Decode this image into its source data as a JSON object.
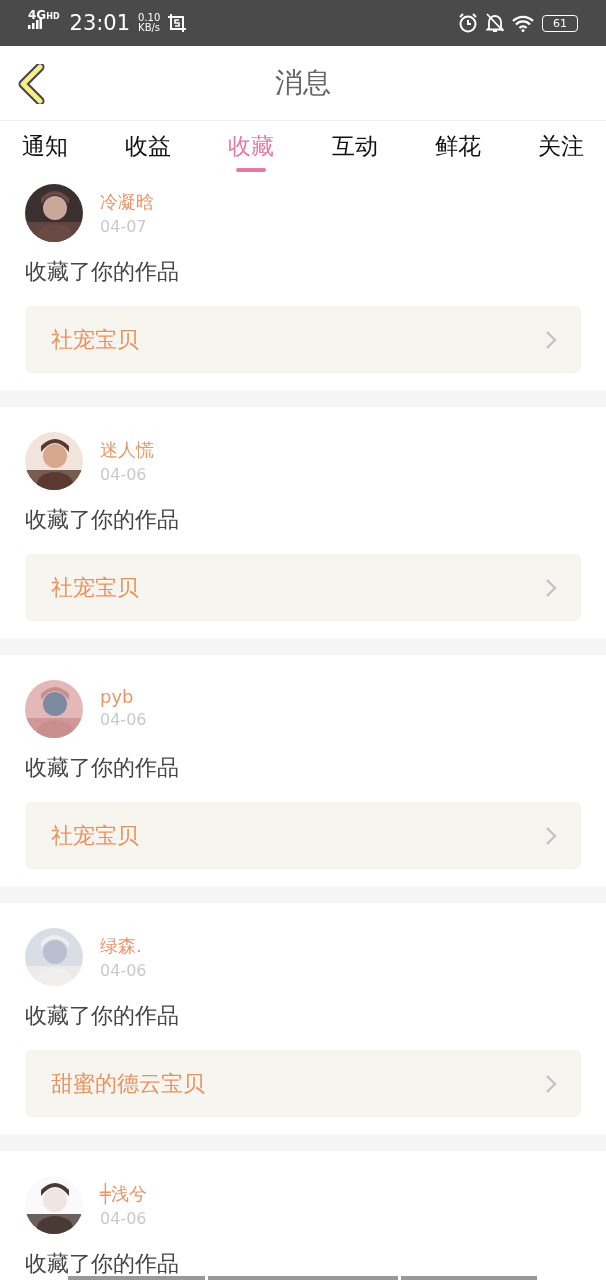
{
  "status_bar": {
    "network": "4G",
    "network_badge": "HD",
    "time": "23:01",
    "speed": "0.10",
    "speed_unit": "KB/s",
    "battery": "61"
  },
  "header": {
    "title": "消息"
  },
  "tabs": [
    {
      "label": "通知",
      "selected": false
    },
    {
      "label": "收益",
      "selected": false
    },
    {
      "label": "收藏",
      "selected": true
    },
    {
      "label": "互动",
      "selected": false
    },
    {
      "label": "鲜花",
      "selected": false
    },
    {
      "label": "关注",
      "selected": false
    }
  ],
  "messages": [
    {
      "user": "冷凝晗",
      "date": "04-07",
      "text": "收藏了你的作品",
      "work": "社宠宝贝"
    },
    {
      "user": "迷人慌",
      "date": "04-06",
      "text": "收藏了你的作品",
      "work": "社宠宝贝"
    },
    {
      "user": "pyb",
      "date": "04-06",
      "text": "收藏了你的作品",
      "work": "社宠宝贝"
    },
    {
      "user": "绿森.",
      "date": "04-06",
      "text": "收藏了你的作品",
      "work": "甜蜜的德云宝贝"
    },
    {
      "user": "╪浅兮",
      "date": "04-06",
      "text": "收藏了你的作品"
    }
  ]
}
